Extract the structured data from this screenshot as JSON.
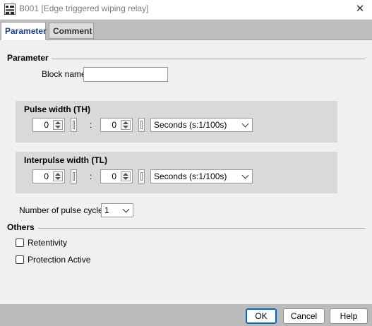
{
  "window": {
    "title": "B001 [Edge triggered wiping relay]"
  },
  "tabs": [
    {
      "label": "Parameter",
      "active": true
    },
    {
      "label": "Comment",
      "active": false
    }
  ],
  "parameter": {
    "group_title": "Parameter",
    "block_name_label": "Block name:",
    "block_name_value": "",
    "pulse_width": {
      "title": "Pulse width (TH)",
      "value1": "0",
      "separator": ":",
      "value2": "0",
      "unit": "Seconds (s:1/100s)"
    },
    "interpulse_width": {
      "title": "Interpulse width (TL)",
      "value1": "0",
      "separator": ":",
      "value2": "0",
      "unit": "Seconds (s:1/100s)"
    },
    "pulse_cycles_label": "Number of pulse cycles:",
    "pulse_cycles_value": "1"
  },
  "others": {
    "group_title": "Others",
    "retentivity_label": "Retentivity",
    "retentivity_checked": false,
    "protection_label": "Protection Active",
    "protection_checked": false
  },
  "footer": {
    "ok_label": "OK",
    "cancel_label": "Cancel",
    "help_label": "Help"
  },
  "icons": {
    "app": "block-icon",
    "close": "close-icon"
  }
}
